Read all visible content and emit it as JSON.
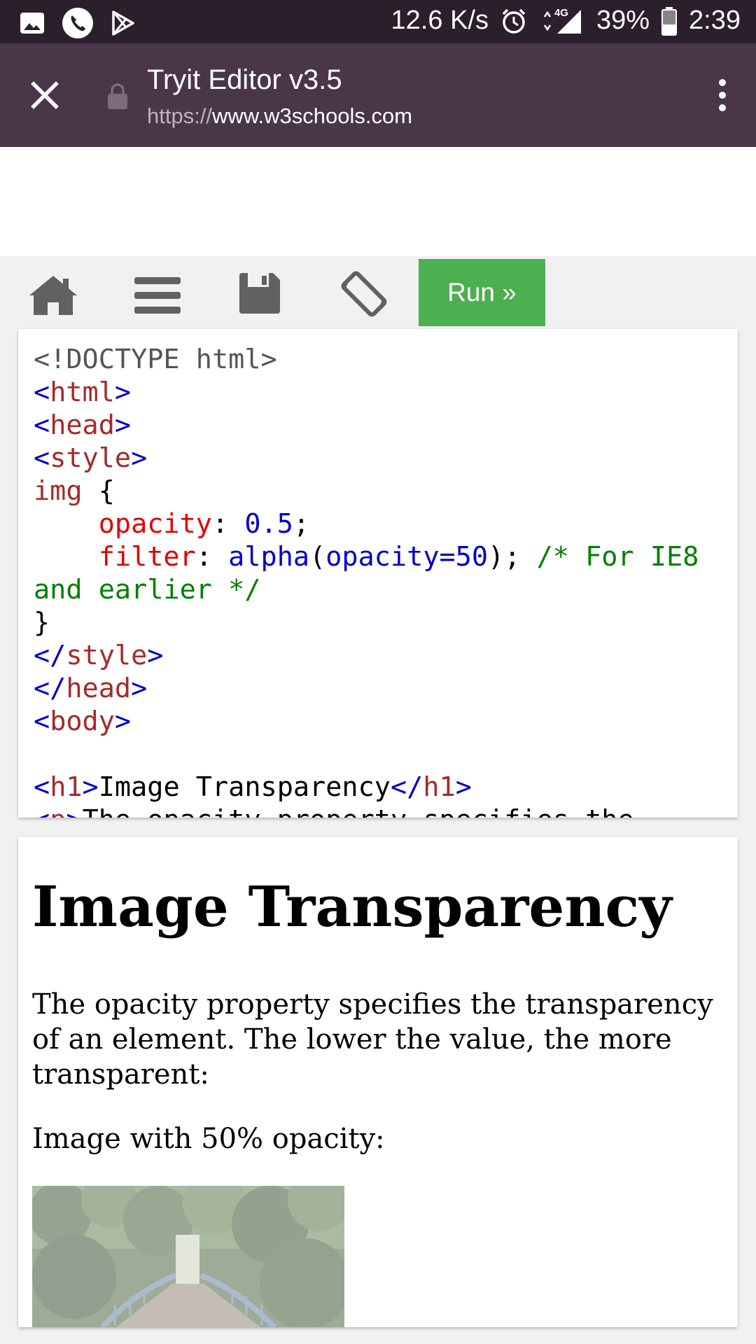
{
  "status_bar": {
    "net_speed": "12.6 K/s",
    "network": "4G",
    "battery": "39%",
    "time": "2:39"
  },
  "browser": {
    "title": "Tryit Editor v3.5",
    "url_scheme": "https://",
    "url_host": "www.w3schools.com"
  },
  "editor_toolbar": {
    "run_label": "Run »"
  },
  "code": {
    "l1": "<!DOCTYPE html>",
    "l2_open": "<",
    "l2_name": "html",
    "l2_close": ">",
    "l3_open": "<",
    "l3_name": "head",
    "l3_close": ">",
    "l4_open": "<",
    "l4_name": "style",
    "l4_close": ">",
    "l5_sel": "img",
    "l5_brace": " {",
    "l6_prop": "opacity",
    "l6_colon": ": ",
    "l6_val": "0.5",
    "l6_semi": ";",
    "l7_prop": "filter",
    "l7_colon": ": ",
    "l7_fn": "alpha",
    "l7_paren1": "(",
    "l7_arg": "opacity=50",
    "l7_paren2": "); ",
    "l7_cmt": "/* For IE8",
    "l8_cmt": "and earlier */",
    "l9": "}",
    "l10_open": "</",
    "l10_name": "style",
    "l10_close": ">",
    "l11_open": "</",
    "l11_name": "head",
    "l11_close": ">",
    "l12_open": "<",
    "l12_name": "body",
    "l12_close": ">",
    "l14_open": "<",
    "l14_name": "h1",
    "l14_close": ">",
    "l14_text": "Image Transparency",
    "l14_eopen": "</",
    "l14_ename": "h1",
    "l14_eclose": ">",
    "l15_open": "<",
    "l15_name": "p",
    "l15_close": ">",
    "l15_text": "The opacity property specifies the"
  },
  "result": {
    "heading": "Image Transparency",
    "paragraph": "The opacity property specifies the transparency of an element. The lower the value, the more transparent:",
    "caption": "Image with 50% opacity:"
  }
}
